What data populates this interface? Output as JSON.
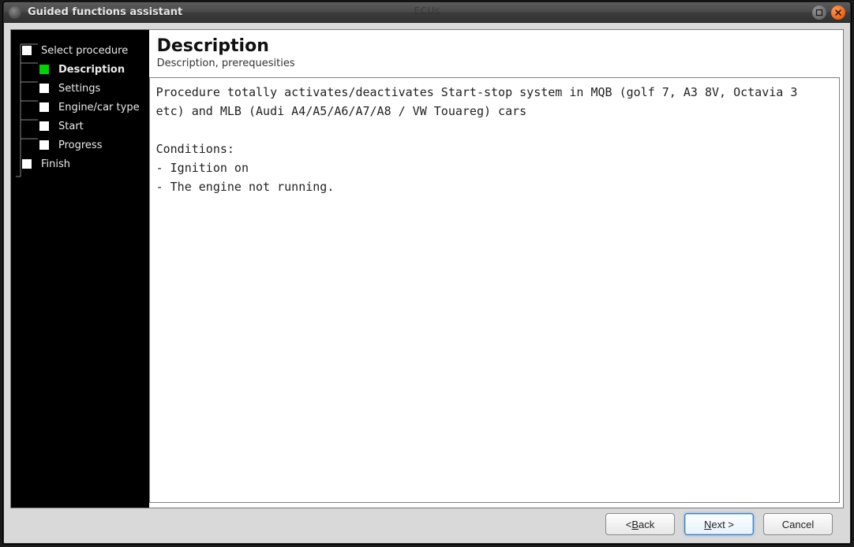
{
  "window": {
    "title": "Guided functions assistant",
    "background_label": "ECUs"
  },
  "sidebar": {
    "steps": [
      {
        "label": "Select procedure",
        "state": "first"
      },
      {
        "label": "Description",
        "state": "active"
      },
      {
        "label": "Settings",
        "state": "pending"
      },
      {
        "label": "Engine/car type",
        "state": "pending"
      },
      {
        "label": "Start",
        "state": "pending"
      },
      {
        "label": "Progress",
        "state": "pending"
      },
      {
        "label": "Finish",
        "state": "last"
      }
    ]
  },
  "main": {
    "title": "Description",
    "subtitle": "Description, prerequesities",
    "description_text": "Procedure totally activates/deactivates Start-stop system in MQB (golf 7, A3 8V, Octavia 3 etc) and MLB (Audi A4/A5/A6/A7/A8 / VW Touareg) cars\n\nConditions:\n- Ignition on\n- The engine not running."
  },
  "footer": {
    "back_prefix": "< ",
    "back_hot": "B",
    "back_rest": "ack",
    "next_hot": "N",
    "next_rest": "ext >",
    "cancel": "Cancel"
  }
}
